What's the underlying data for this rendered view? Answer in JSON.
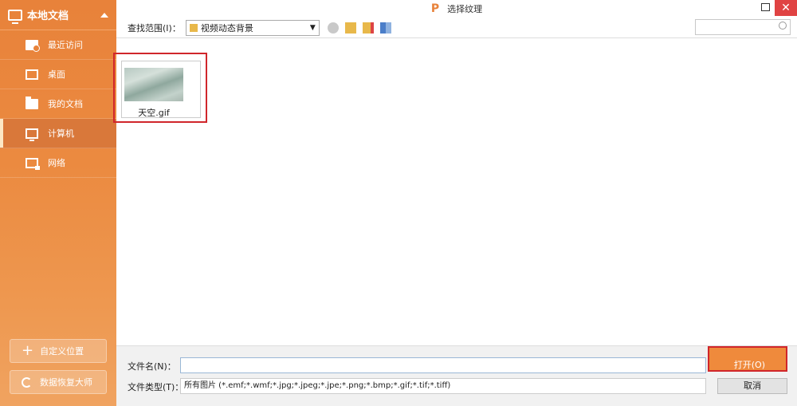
{
  "sidebar": {
    "title": "本地文档",
    "items": [
      {
        "label": "最近访问",
        "icon": "recent-folder-icon"
      },
      {
        "label": "桌面",
        "icon": "desktop-icon"
      },
      {
        "label": "我的文档",
        "icon": "folder-icon"
      },
      {
        "label": "计算机",
        "icon": "computer-icon",
        "active": true
      },
      {
        "label": "网络",
        "icon": "network-icon"
      }
    ],
    "custom_location": "自定义位置",
    "data_recovery": "数据恢复大师"
  },
  "titlebar": {
    "app_icon": "P",
    "title": "选择纹理"
  },
  "toolbar": {
    "look_in_label": "查找范围(I)：",
    "current_folder": "视频动态背景",
    "search_placeholder": ""
  },
  "files": [
    {
      "name": "天空.gif",
      "selected": true
    }
  ],
  "bottom": {
    "filename_label": "文件名(N)：",
    "filename_value": "",
    "filetype_label": "文件类型(T)：",
    "filetype_value": "所有图片 (*.emf;*.wmf;*.jpg;*.jpeg;*.jpe;*.png;*.bmp;*.gif;*.tif;*.tiff)",
    "open_button": "打开(O)",
    "cancel_button": "取消"
  },
  "colors": {
    "sidebar": "#e8823a",
    "highlight": "#d0262b",
    "close": "#e04343"
  }
}
